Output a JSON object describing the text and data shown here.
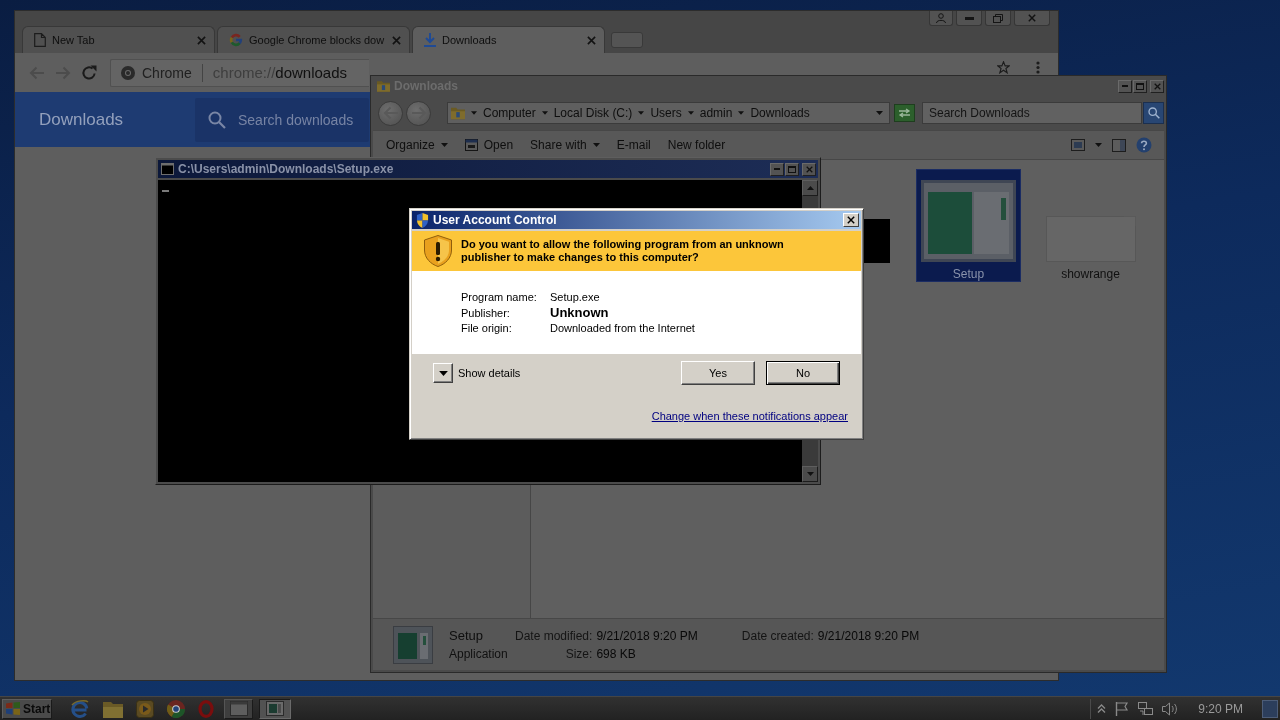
{
  "chrome": {
    "tabs": [
      {
        "title": "New Tab",
        "kind": "page",
        "selected": false
      },
      {
        "title": "Google Chrome blocks dow",
        "kind": "google",
        "selected": false
      },
      {
        "title": "Downloads",
        "kind": "download",
        "selected": true
      }
    ],
    "omnibox": {
      "chip": "Chrome",
      "scheme": "chrome://",
      "path": "downloads"
    },
    "page": {
      "title": "Downloads",
      "search_placeholder": "Search downloads"
    }
  },
  "explorer": {
    "title": "Downloads",
    "breadcrumb": [
      "Computer",
      "Local Disk (C:)",
      "Users",
      "admin",
      "Downloads"
    ],
    "search_placeholder": "Search Downloads",
    "toolbar": [
      {
        "label": "Organize",
        "dropdown": true,
        "has_icon": false
      },
      {
        "label": "Open",
        "dropdown": false,
        "has_icon": true
      },
      {
        "label": "Share with",
        "dropdown": true,
        "has_icon": false
      },
      {
        "label": "E-mail",
        "dropdown": false,
        "has_icon": false
      },
      {
        "label": "New folder",
        "dropdown": false,
        "has_icon": false
      }
    ],
    "files": [
      {
        "kind": "console",
        "selected": false
      },
      {
        "kind": "app",
        "name": "Setup",
        "selected": true
      },
      {
        "kind": "blank",
        "name": "showrange",
        "selected": false
      }
    ],
    "details": {
      "name": "Setup",
      "type": "Application",
      "fields": [
        {
          "label": "Date modified:",
          "value": "9/21/2018 9:20 PM"
        },
        {
          "label": "Size:",
          "value": "698 KB"
        },
        {
          "label": "Date created:",
          "value": "9/21/2018 9:20 PM"
        }
      ]
    }
  },
  "console": {
    "title": "C:\\Users\\admin\\Downloads\\Setup.exe"
  },
  "uac": {
    "title": "User Account Control",
    "question": "Do you want to allow the following program from an unknown publisher to make changes to this computer?",
    "rows": [
      {
        "label": "Program name:",
        "value": "Setup.exe",
        "emphasis": false
      },
      {
        "label": "Publisher:",
        "value": "Unknown",
        "emphasis": true
      },
      {
        "label": "File origin:",
        "value": "Downloaded from the Internet",
        "emphasis": false
      }
    ],
    "details_toggle": {
      "label": "Show details",
      "expanded": false
    },
    "buttons": [
      {
        "label": "Yes",
        "default": false
      },
      {
        "label": "No",
        "default": true
      }
    ],
    "link": "Change when these notifications appear"
  },
  "taskbar": {
    "start": "Start",
    "apps": [
      {
        "kind": "ie",
        "selected": false
      },
      {
        "kind": "folder",
        "selected": false
      },
      {
        "kind": "media",
        "selected": false
      },
      {
        "kind": "chrome",
        "selected": false
      },
      {
        "kind": "opera",
        "selected": false
      },
      {
        "kind": "explorer-window",
        "selected": false
      },
      {
        "kind": "console-window",
        "selected": true
      }
    ],
    "clock": "9:20 PM"
  }
}
